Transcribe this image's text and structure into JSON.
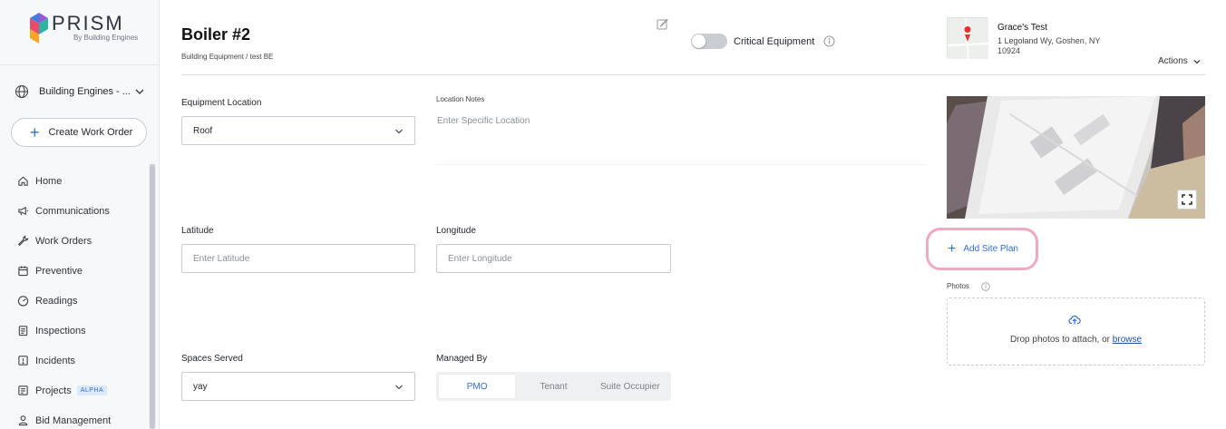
{
  "brand": {
    "name": "PRISM",
    "tagline": "By Building Engines"
  },
  "sidebar": {
    "org_name": "Building Engines - ...",
    "create_label": "Create Work Order",
    "items": [
      {
        "label": "Home",
        "icon": "home-icon"
      },
      {
        "label": "Communications",
        "icon": "megaphone-icon"
      },
      {
        "label": "Work Orders",
        "icon": "wrench-icon"
      },
      {
        "label": "Preventive",
        "icon": "calendar-icon"
      },
      {
        "label": "Readings",
        "icon": "gauge-icon"
      },
      {
        "label": "Inspections",
        "icon": "clipboard-icon"
      },
      {
        "label": "Incidents",
        "icon": "alert-icon"
      },
      {
        "label": "Projects",
        "icon": "projects-icon",
        "badge": "ALPHA"
      },
      {
        "label": "Bid Management",
        "icon": "person-icon"
      }
    ]
  },
  "header": {
    "title": "Boiler #2",
    "breadcrumb": "Building Equipment / test BE",
    "critical_label": "Critical Equipment",
    "critical_on": false,
    "property_name": "Grace's Test",
    "address_line1": "1 Legoland Wy, Goshen, NY",
    "address_line2": "10924",
    "actions_label": "Actions"
  },
  "form": {
    "location_label": "Equipment Location",
    "location_value": "Roof",
    "notes_label": "Location Notes",
    "notes_placeholder": "Enter Specific Location",
    "latitude_label": "Latitude",
    "latitude_placeholder": "Enter Latitude",
    "longitude_label": "Longitude",
    "longitude_placeholder": "Enter Longitude",
    "spaces_label": "Spaces Served",
    "spaces_value": "yay",
    "managed_label": "Managed By",
    "managed_options": [
      "PMO",
      "Tenant",
      "Suite Occupier"
    ],
    "managed_selected": "PMO"
  },
  "right": {
    "add_site_plan": "Add Site Plan",
    "photos_label": "Photos",
    "drop_text": "Drop photos to attach, or",
    "browse_label": "browse"
  },
  "colors": {
    "accent": "#2f6fd6",
    "highlight": "#f2a7c3",
    "toggle_off": "#c9ccd1"
  }
}
